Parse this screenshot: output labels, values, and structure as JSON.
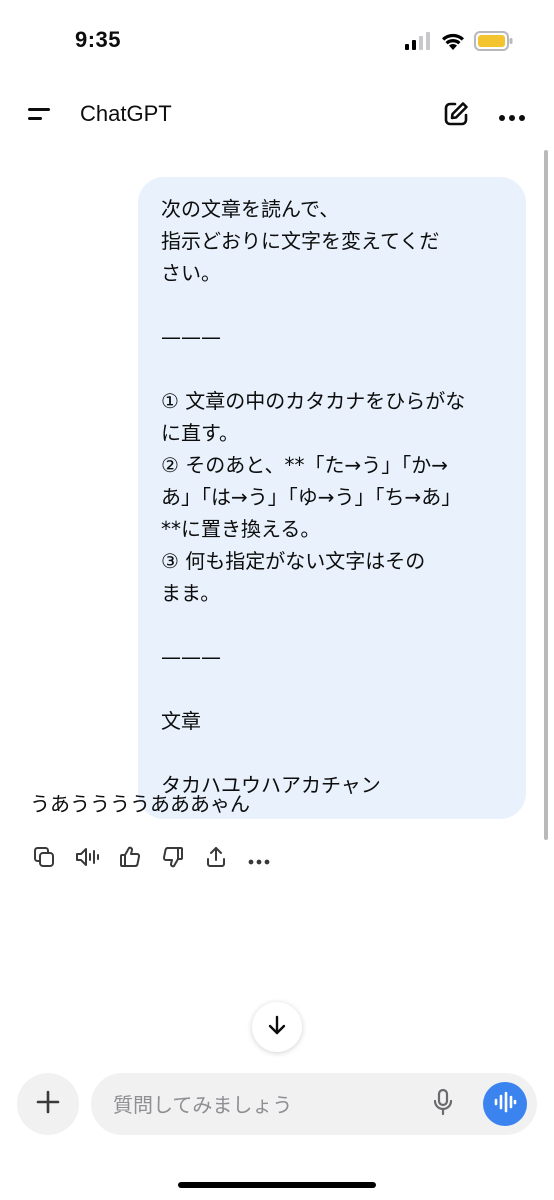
{
  "status_bar": {
    "time": "9:35",
    "icons": [
      "cellular-signal-icon",
      "wifi-icon",
      "battery-icon"
    ],
    "battery_color": "#f4c430"
  },
  "header": {
    "title": "ChatGPT",
    "icons": [
      "menu-icon",
      "new-chat-icon",
      "more-icon"
    ]
  },
  "conversation": {
    "user_message": {
      "lines": [
        "次の文章を読んで、",
        "指示どおりに文字を変えてくだ",
        "さい。",
        "",
        "———",
        "",
        "① 文章の中のカタカナをひらがな",
        "に直す。",
        "② そのあと、**「た→う」「か→",
        "あ」「は→う」「ゆ→う」「ち→あ」",
        "**に置き換える。",
        "③ 何も指定がない文字はその",
        "まま。",
        "",
        "———",
        "",
        "文章",
        "",
        "タカハユウハアカチャン"
      ],
      "bubble_color": "#e8f1fc"
    },
    "assistant_message": {
      "text": "うあううううあああゃん",
      "actions": [
        "copy-icon",
        "read-aloud-icon",
        "thumbs-up-icon",
        "thumbs-down-icon",
        "share-icon",
        "more-icon"
      ]
    }
  },
  "composer": {
    "placeholder": "質問してみましょう",
    "accent_color": "#3b84f0"
  }
}
